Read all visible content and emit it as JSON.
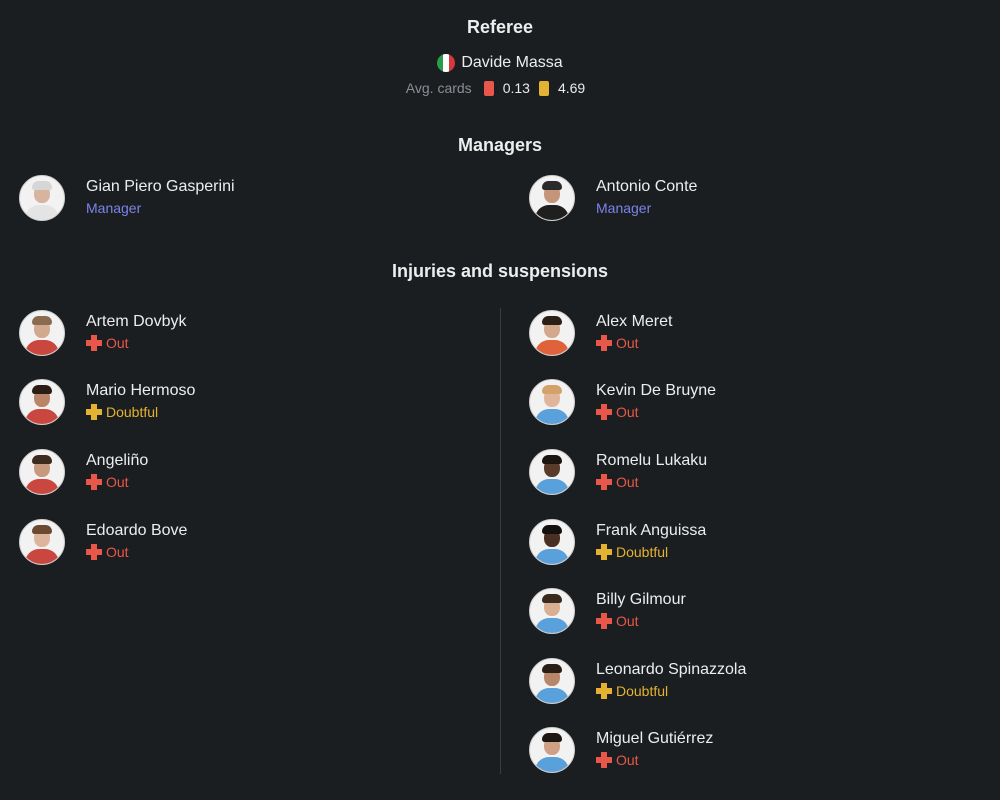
{
  "referee": {
    "title": "Referee",
    "name": "Davide Massa",
    "flag_icon": "italy-flag-icon",
    "avg_cards_label": "Avg. cards",
    "red_card_avg": "0.13",
    "yellow_card_avg": "4.69",
    "red_color": "#e8574a",
    "yellow_color": "#e3b230"
  },
  "managers": {
    "title": "Managers",
    "home": {
      "name": "Gian Piero Gasperini",
      "role": "Manager"
    },
    "away": {
      "name": "Antonio Conte",
      "role": "Manager"
    }
  },
  "injuries": {
    "title": "Injuries and suspensions",
    "home": [
      {
        "name": "Artem Dovbyk",
        "status": "Out"
      },
      {
        "name": "Mario Hermoso",
        "status": "Doubtful"
      },
      {
        "name": "Angeliño",
        "status": "Out"
      },
      {
        "name": "Edoardo Bove",
        "status": "Out"
      }
    ],
    "away": [
      {
        "name": "Alex Meret",
        "status": "Out"
      },
      {
        "name": "Kevin De Bruyne",
        "status": "Out"
      },
      {
        "name": "Romelu Lukaku",
        "status": "Out"
      },
      {
        "name": "Frank Anguissa",
        "status": "Doubtful"
      },
      {
        "name": "Billy Gilmour",
        "status": "Out"
      },
      {
        "name": "Leonardo Spinazzola",
        "status": "Doubtful"
      },
      {
        "name": "Miguel Gutiérrez",
        "status": "Out"
      }
    ]
  },
  "colors": {
    "background": "#1b1e21",
    "manager_role": "#7b83ea",
    "out": "#e8574a",
    "doubtful": "#e3b230"
  }
}
